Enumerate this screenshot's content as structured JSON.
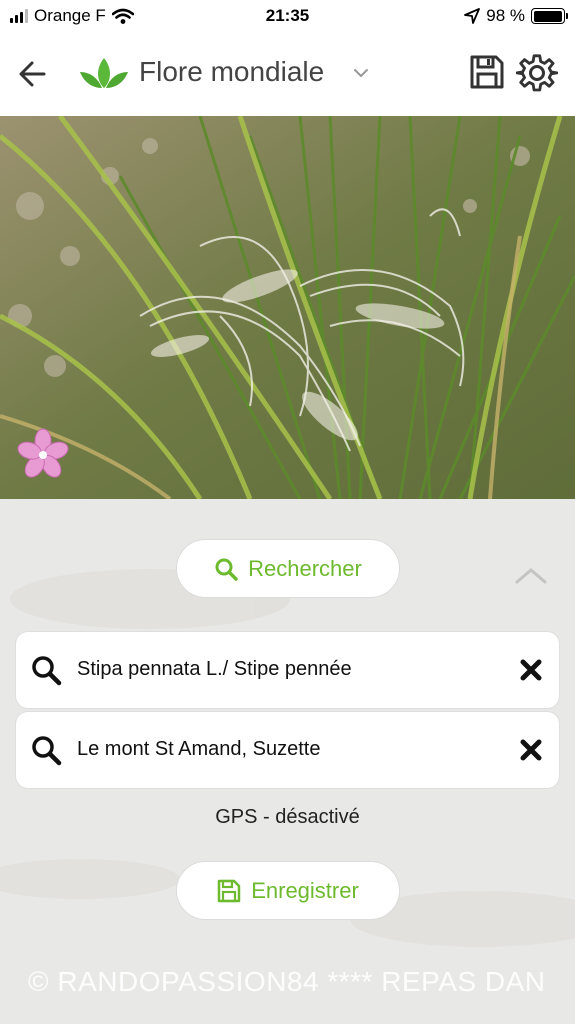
{
  "status": {
    "carrier": "Orange F",
    "time": "21:35",
    "battery_pct": "98 %",
    "battery_level": 0.98
  },
  "header": {
    "title": "Flore mondiale"
  },
  "actions": {
    "search_label": "Rechercher",
    "save_label": "Enregistrer"
  },
  "fields": [
    {
      "value": "Stipa pennata L./ Stipe pennée"
    },
    {
      "value": "Le mont St Amand, Suzette"
    }
  ],
  "gps_status": "GPS - désactivé",
  "watermark": "© RANDOPASSION84 ****   REPAS DAN",
  "colors": {
    "accent": "#6dba2e",
    "panel": "#e8e8e7",
    "watermark": "#ffffff",
    "flower": "#e89ad2"
  },
  "icons": [
    "signal-icon",
    "wifi-icon",
    "location-arrow-icon",
    "battery-icon",
    "back-arrow-icon",
    "plant-logo-icon",
    "chevron-down-icon",
    "save-icon",
    "gear-icon",
    "flower-icon",
    "search-icon",
    "chevron-up-icon",
    "close-icon"
  ]
}
